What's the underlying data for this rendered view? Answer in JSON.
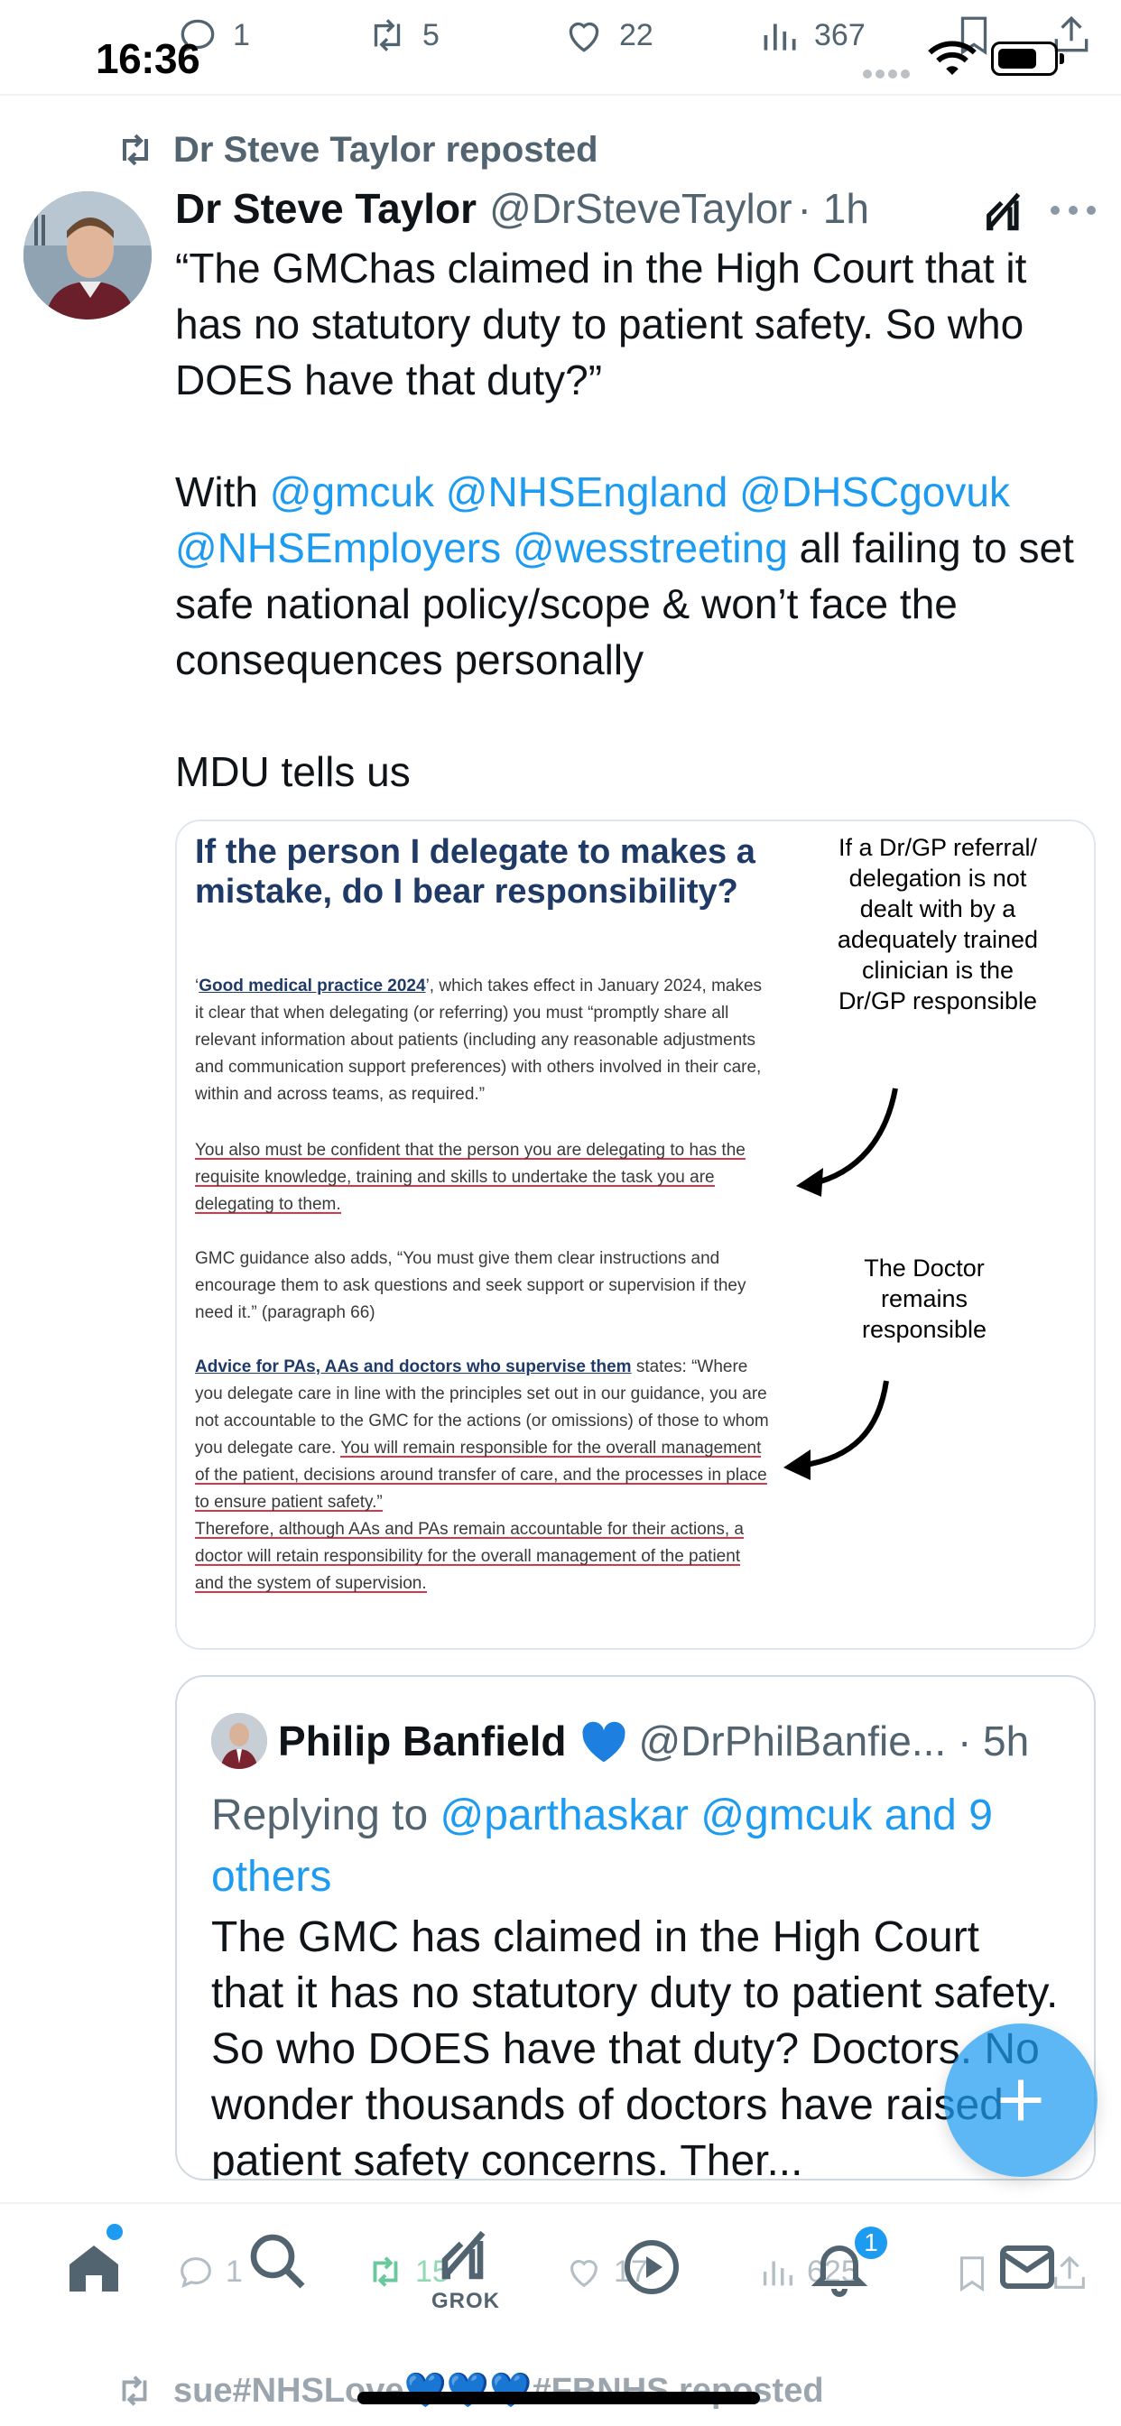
{
  "status_bar": {
    "time": "16:36"
  },
  "prev_tweet_actions": {
    "replies": "1",
    "reposts": "5",
    "likes": "22",
    "views": "367"
  },
  "tweet": {
    "repost_label": "Dr Steve Taylor reposted",
    "author_name": "Dr Steve Taylor",
    "author_handle": "@DrSteveTaylor",
    "time": "· 1h",
    "p1": "“The GMChas claimed in the High Court that it has no statutory duty to patient safety. So who DOES have that duty?”",
    "p2_start": "With ",
    "mentions": [
      "@gmcuk",
      "@NHSEngland",
      "@DHSCgovuk",
      "@NHSEmployers",
      "@wesstreeting"
    ],
    "p2_end": " all failing to set safe national policy/scope & won’t face the consequences personally",
    "p3": "MDU tells us"
  },
  "media": {
    "title": "If the person I delegate to makes a mistake, do I bear responsibility?",
    "para1_link": "Good medical practice 2024",
    "para1_rest": "’, which takes effect in January 2024, makes it clear that when delegating (or referring) you must “promptly share all relevant information about patients (including any reasonable adjustments and communication support preferences) with others involved in their care, within and across teams, as required.”",
    "para1_quote": "‘",
    "para2": "You also must be confident that the person you are delegating to has the requisite knowledge, training and skills to undertake the task you are delegating to them.",
    "para3": "GMC guidance also adds, “You must give them clear instructions and encourage them to ask questions and seek support or supervision if they need it.” (paragraph 66)",
    "para4_link": "Advice for PAs, AAs and doctors who supervise them",
    "para4_a": " states: “Where you delegate care in line with the principles set out in our guidance, you are not accountable to the GMC for the actions (or omissions) of those to whom you delegate care. ",
    "para4_b": "You will remain responsible for the overall management of the patient, decisions around transfer of care, and the processes in place to ensure patient safety.”",
    "para5": "Therefore, although AAs and PAs remain accountable for their actions, a doctor will retain responsibility for the overall management of the patient and the system of supervision.",
    "note1": "If a Dr/GP referral/ delegation is not dealt with by a adequately trained clinician is the Dr/GP responsible",
    "note2": "The Doctor remains responsible"
  },
  "quote": {
    "name": "Philip Banfield",
    "handle": "@DrPhilBanfie... · 5h",
    "replying_prefix": "Replying to ",
    "replying_targets": "@parthaskar @gmcuk and 9 others",
    "text": "The GMC has claimed in the High Court that it has no statutory duty to patient safety. So who DOES have that duty? Doctors. No wonder thousands of doctors have raised patient safety concerns. Ther..."
  },
  "bottom_ghost_actions": {
    "replies": "1",
    "reposts": "15",
    "likes": "17",
    "views": "625"
  },
  "bottom_nav": {
    "grok_label": "GROK",
    "notifications_badge": "1"
  },
  "next_tweet": {
    "repost_label": "sue#NHSLove💙💙💙#FBNHS reposted"
  },
  "colors": {
    "accent": "#1d9bf0",
    "text": "#0f1419",
    "muted": "#536471",
    "doc_title": "#1f3a66",
    "underline": "#d8374a"
  },
  "icons": [
    "reply-icon",
    "repost-icon",
    "like-icon",
    "views-icon",
    "bookmark-icon",
    "share-icon",
    "grok-icon",
    "more-icon",
    "home-icon",
    "search-icon",
    "communities-icon",
    "notifications-icon",
    "messages-icon",
    "compose-icon"
  ]
}
